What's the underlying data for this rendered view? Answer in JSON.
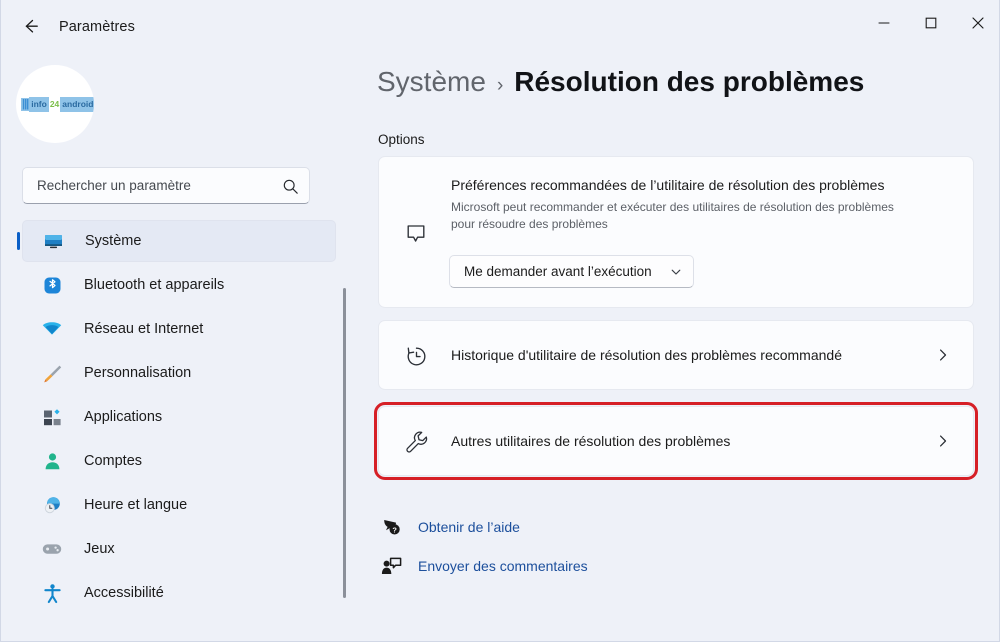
{
  "window": {
    "app_title": "Paramètres",
    "back_icon": "arrow-left-icon",
    "minimize_label": "–",
    "maximize_label": "□",
    "close_label": "✕"
  },
  "sidebar": {
    "avatar": {
      "icon": "user-avatar",
      "logo_bars": "|||",
      "logo_info": "info",
      "logo_mid": "24",
      "logo_android": "android"
    },
    "search": {
      "placeholder": "Rechercher un paramètre",
      "value": "",
      "icon": "search-icon"
    },
    "items": [
      {
        "label": "Système",
        "icon": "monitor-icon",
        "selected": true
      },
      {
        "label": "Bluetooth et appareils",
        "icon": "bluetooth-icon",
        "selected": false
      },
      {
        "label": "Réseau et Internet",
        "icon": "wifi-icon",
        "selected": false
      },
      {
        "label": "Personnalisation",
        "icon": "paintbrush-icon",
        "selected": false
      },
      {
        "label": "Applications",
        "icon": "apps-icon",
        "selected": false
      },
      {
        "label": "Comptes",
        "icon": "person-icon",
        "selected": false
      },
      {
        "label": "Heure et langue",
        "icon": "clock-globe-icon",
        "selected": false
      },
      {
        "label": "Jeux",
        "icon": "gamepad-icon",
        "selected": false
      },
      {
        "label": "Accessibilité",
        "icon": "accessibility-icon",
        "selected": false
      }
    ]
  },
  "main": {
    "breadcrumb": {
      "parent": "Système",
      "separator": "›",
      "current": "Résolution des problèmes"
    },
    "section_label": "Options",
    "cards": [
      {
        "id": "prefs",
        "icon": "callout-bubble-icon",
        "title": "Préférences recommandées de l’utilitaire de résolution des problèmes",
        "description": "Microsoft peut recommander et exécuter des utilitaires de résolution des problèmes pour résoudre des problèmes",
        "dropdown": {
          "selected": "Me demander avant l’exécution",
          "chevron_icon": "chevron-down-icon"
        }
      },
      {
        "id": "history",
        "icon": "history-icon",
        "title": "Historique d'utilitaire de résolution des problèmes recommandé",
        "chevron_icon": "chevron-right-icon"
      },
      {
        "id": "others",
        "icon": "wrench-icon",
        "title": "Autres utilitaires de résolution des problèmes",
        "chevron_icon": "chevron-right-icon",
        "highlighted": true
      }
    ],
    "links": [
      {
        "label": "Obtenir de l’aide",
        "icon": "help-bubble-icon"
      },
      {
        "label": "Envoyer des commentaires",
        "icon": "feedback-icon"
      }
    ]
  },
  "colors": {
    "accent": "#0a5fc7",
    "highlight": "#d61f26",
    "link": "#1c4f9c",
    "background": "#eef1f8",
    "card": "#fbfcfe"
  }
}
